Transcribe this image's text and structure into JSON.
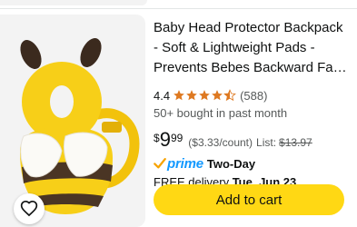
{
  "product": {
    "title": "Baby Head Protector Backpack - Soft & Lightweight Pads - Prevents Bebes Backward Fall Injuries",
    "rating": "4.4",
    "stars_filled": 4.4,
    "reviews": "(588)",
    "bought": "50+ bought in past month",
    "price": {
      "symbol": "$",
      "whole": "9",
      "fraction": "99"
    },
    "unit_price": "($3.33/count)",
    "list_label": "List:",
    "list_price": "$13.97",
    "prime": {
      "brand": "prime",
      "speed": "Two-Day"
    },
    "delivery": {
      "prefix": "FREE delivery",
      "date": "Tue, Jun 23"
    },
    "add_to_cart": "Add to cart"
  },
  "colors": {
    "star": "#de7921",
    "prime_blue": "#1399ff",
    "prime_check": "#f7a300",
    "button_yellow": "#ffd814",
    "secondary_text": "#565959"
  },
  "icons": {
    "wishlist": "heart-outline-icon",
    "prime": "prime-check-icon",
    "rating": "star-icon"
  }
}
